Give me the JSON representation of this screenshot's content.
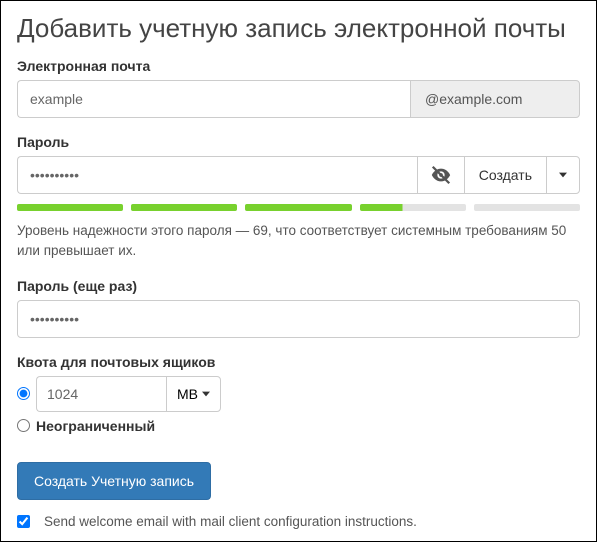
{
  "title": "Добавить учетную запись электронной почты",
  "email": {
    "label": "Электронная почта",
    "value": "example",
    "domain": "@example.com"
  },
  "password": {
    "label": "Пароль",
    "value": "••••••••••",
    "generate_label": "Создать",
    "strength_text": "Уровень надежности этого пароля — 69, что соответствует системным требованиям 50 или превышает их."
  },
  "password_confirm": {
    "label": "Пароль (еще раз)",
    "value": "••••••••••"
  },
  "quota": {
    "label": "Квота для почтовых ящиков",
    "value": "1024",
    "unit": "MB",
    "unlimited_label": "Неограниченный"
  },
  "submit_label": "Создать Учетную запись",
  "welcome_checkbox_label": "Send welcome email with mail client configuration instructions."
}
